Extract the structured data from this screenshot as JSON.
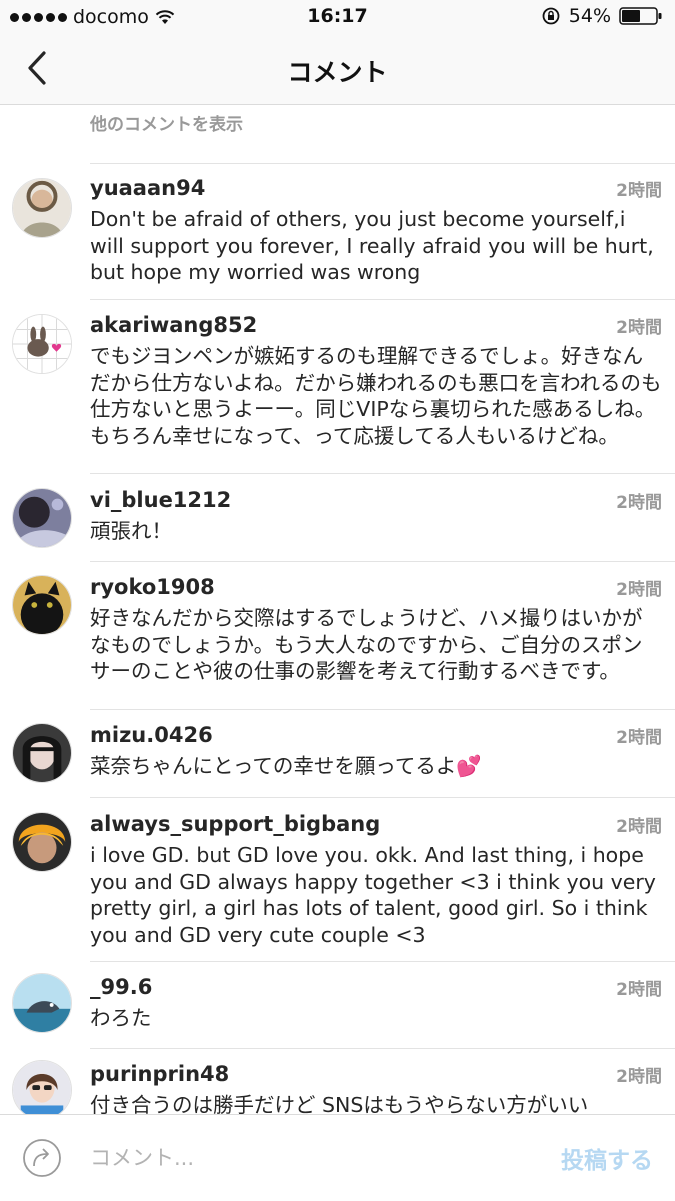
{
  "status_bar": {
    "carrier": "docomo",
    "time": "16:17",
    "battery": "54%",
    "icons": [
      "signal-dots-icon",
      "wifi-icon",
      "rotation-lock-icon",
      "battery-icon"
    ]
  },
  "nav": {
    "title": "コメント",
    "back_icon": "chevron-left-icon"
  },
  "show_more_label": "他のコメントを表示",
  "comments": [
    {
      "username": "yuaaan94",
      "time": "2時間",
      "text": "Don't be afraid of others, you just become yourself,i will support you forever, I really afraid you will be hurt, but hope my worried was wrong"
    },
    {
      "username": "akariwang852",
      "time": "2時間",
      "text": "でもジヨンペンが嫉妬するのも理解できるでしょ。好きなんだから仕方ないよね。だから嫌われるのも悪口を言われるのも仕方ないと思うよーー。同じVIPなら裏切られた感あるしね。もちろん幸せになって、って応援してる人もいるけどね。"
    },
    {
      "username": "vi_blue1212",
      "time": "2時間",
      "text": "頑張れ！"
    },
    {
      "username": "ryoko1908",
      "time": "2時間",
      "text": "好きなんだから交際はするでしょうけど、ハメ撮りはいかがなものでしょうか。もう大人なのですから、ご自分のスポンサーのことや彼の仕事の影響を考えて行動するべきです。"
    },
    {
      "username": "mizu.0426",
      "time": "2時間",
      "text": "菜奈ちゃんにとっての幸せを願ってるよ💕"
    },
    {
      "username": "always_support_bigbang",
      "time": "2時間",
      "text": "i love GD. but GD love you. okk. And last thing, i hope you and GD always happy together <3 i think you very pretty girl, a girl has lots of talent, good girl. So i think you and GD very cute couple <3"
    },
    {
      "username": "_99.6",
      "time": "2時間",
      "text": "わろた"
    },
    {
      "username": "purinprin48",
      "time": "2時間",
      "text": "付き合うのは勝手だけど SNSはもうやらない方がいい"
    }
  ],
  "composer": {
    "placeholder": "コメント...",
    "post_label": "投稿する",
    "share_icon": "share-arrow-icon"
  },
  "colors": {
    "meta_gray": "#999999",
    "text": "#262626",
    "post_disabled_blue": "#b6d8f2"
  }
}
